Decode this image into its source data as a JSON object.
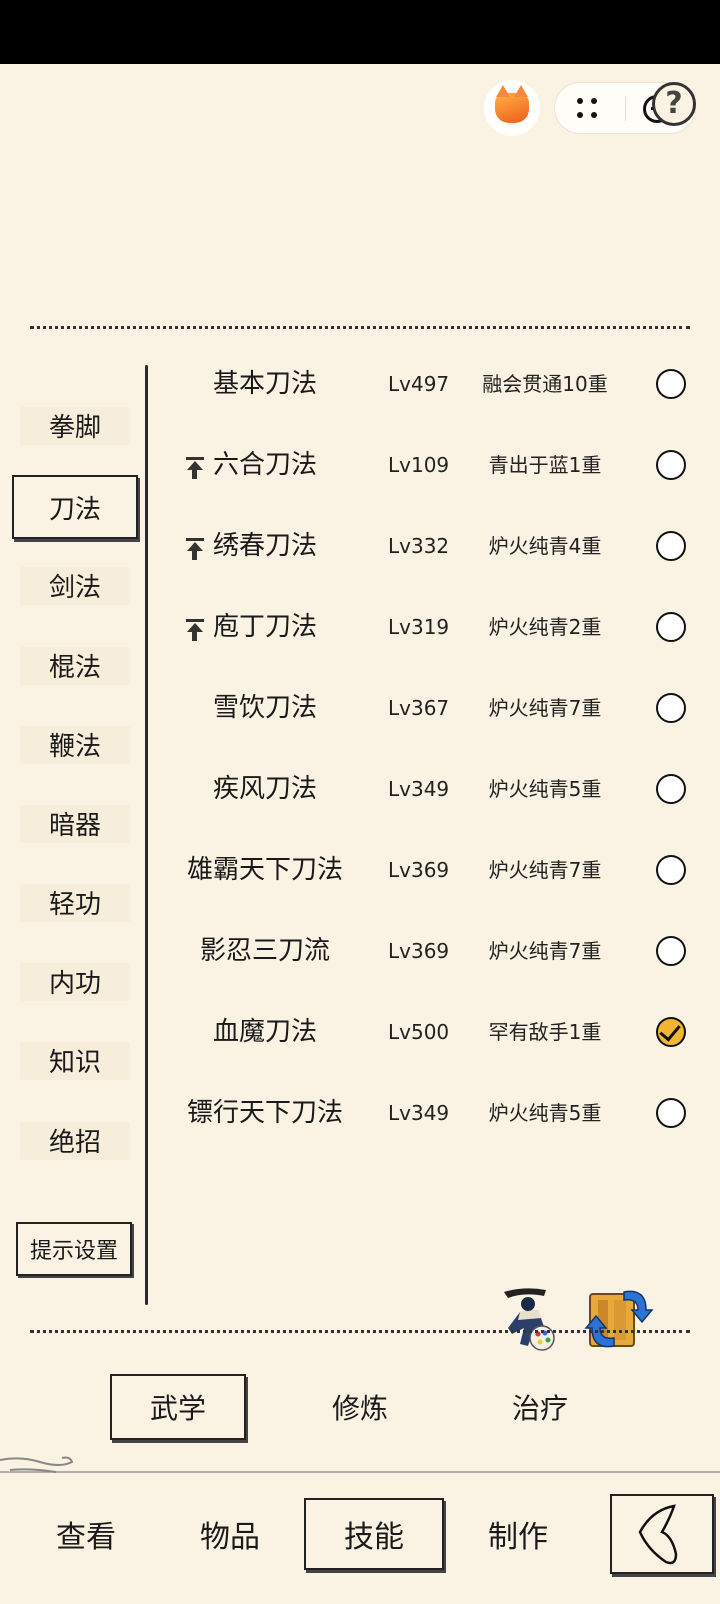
{
  "top": {
    "capsule_icons": [
      "more-dots-icon",
      "close-circle-icon"
    ],
    "help_label": "?"
  },
  "categories": [
    {
      "label": "拳脚",
      "active": false
    },
    {
      "label": "刀法",
      "active": true
    },
    {
      "label": "剑法",
      "active": false
    },
    {
      "label": "棍法",
      "active": false
    },
    {
      "label": "鞭法",
      "active": false
    },
    {
      "label": "暗器",
      "active": false
    },
    {
      "label": "轻功",
      "active": false
    },
    {
      "label": "内功",
      "active": false
    },
    {
      "label": "知识",
      "active": false
    },
    {
      "label": "绝招",
      "active": false
    }
  ],
  "settings_label": "提示设置",
  "skills": [
    {
      "name": "基本刀法",
      "level": "Lv497",
      "rank": "融会贯通10重",
      "upgrade": false,
      "checked": false
    },
    {
      "name": "六合刀法",
      "level": "Lv109",
      "rank": "青出于蓝1重",
      "upgrade": true,
      "checked": false
    },
    {
      "name": "绣春刀法",
      "level": "Lv332",
      "rank": "炉火纯青4重",
      "upgrade": true,
      "checked": false
    },
    {
      "name": "庖丁刀法",
      "level": "Lv319",
      "rank": "炉火纯青2重",
      "upgrade": true,
      "checked": false
    },
    {
      "name": "雪饮刀法",
      "level": "Lv367",
      "rank": "炉火纯青7重",
      "upgrade": false,
      "checked": false
    },
    {
      "name": "疾风刀法",
      "level": "Lv349",
      "rank": "炉火纯青5重",
      "upgrade": false,
      "checked": false
    },
    {
      "name": "雄霸天下刀法",
      "level": "Lv369",
      "rank": "炉火纯青7重",
      "upgrade": false,
      "checked": false
    },
    {
      "name": "影忍三刀流",
      "level": "Lv369",
      "rank": "炉火纯青7重",
      "upgrade": false,
      "checked": false
    },
    {
      "name": "血魔刀法",
      "level": "Lv500",
      "rank": "罕有敌手1重",
      "upgrade": false,
      "checked": true
    },
    {
      "name": "镖行天下刀法",
      "level": "Lv349",
      "rank": "炉火纯青5重",
      "upgrade": false,
      "checked": false
    }
  ],
  "action_icons": [
    "martial-art-customize-icon",
    "skill-swap-icon"
  ],
  "subtabs": [
    {
      "label": "武学",
      "active": true
    },
    {
      "label": "修炼",
      "active": false
    },
    {
      "label": "治疗",
      "active": false
    }
  ],
  "bottom_tabs": [
    {
      "label": "查看",
      "active": false
    },
    {
      "label": "物品",
      "active": false
    },
    {
      "label": "技能",
      "active": true
    },
    {
      "label": "制作",
      "active": false
    }
  ],
  "back_icon": "back-arrow-icon"
}
